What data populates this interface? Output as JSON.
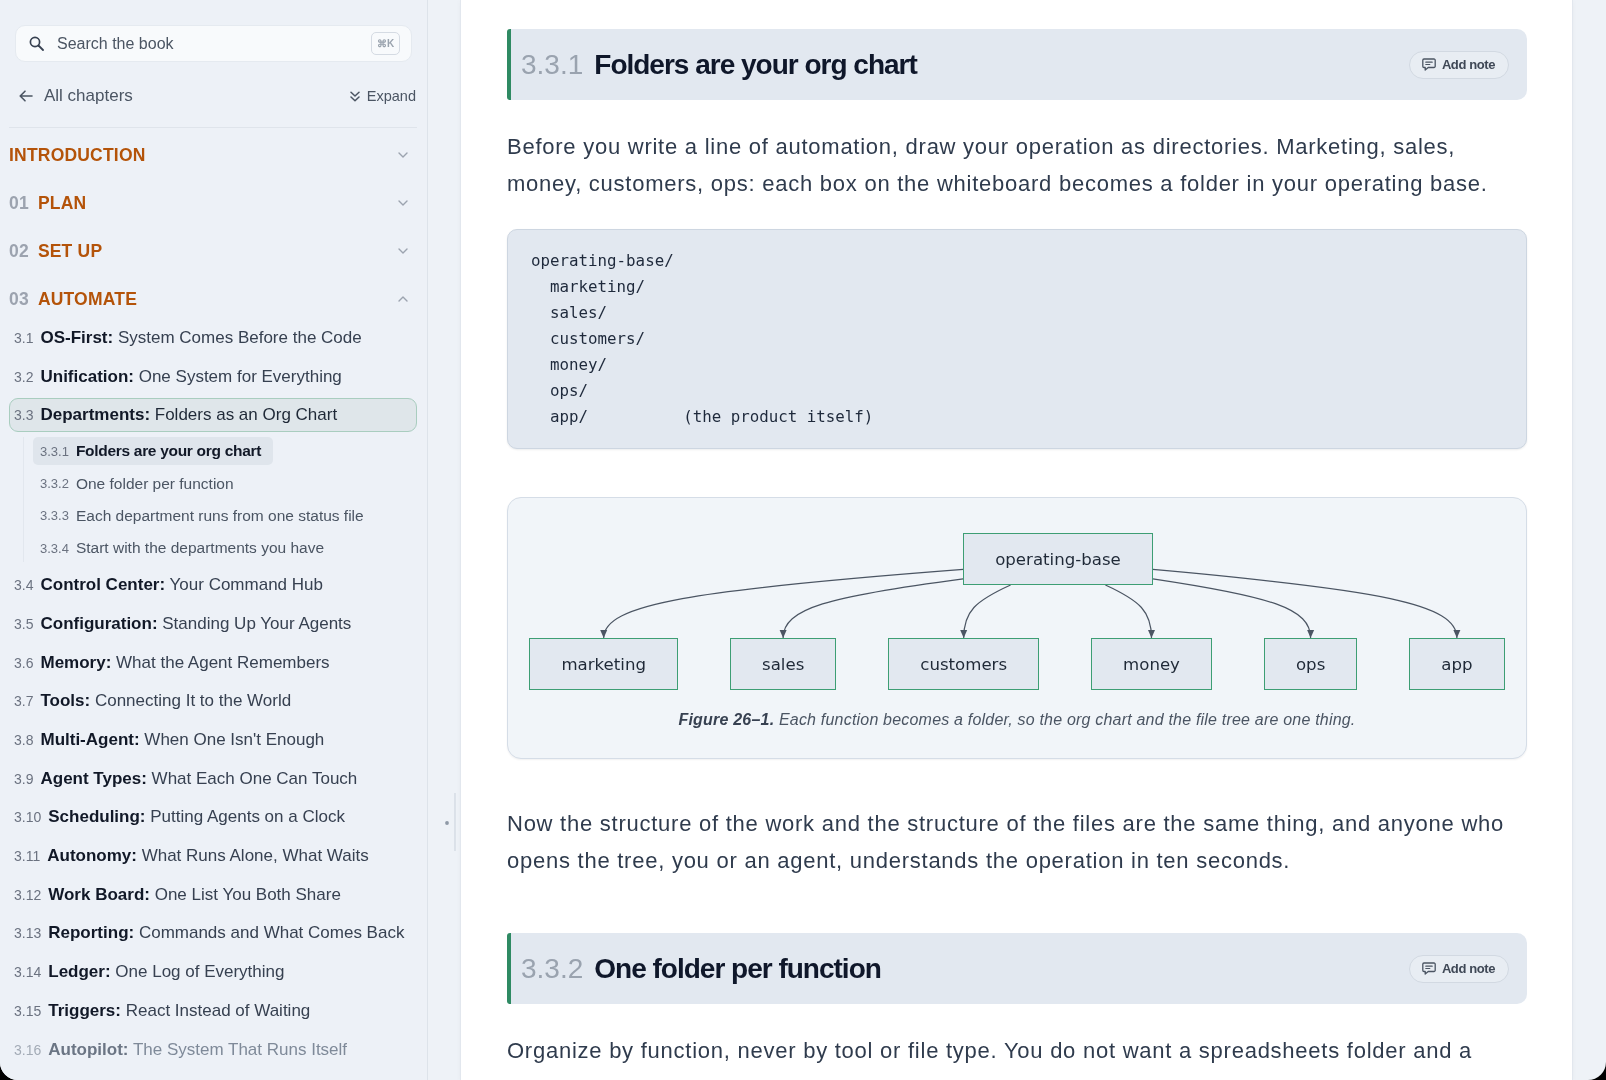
{
  "sidebar": {
    "search": {
      "placeholder": "Search the book",
      "shortcut": "⌘K"
    },
    "back_link": "All chapters",
    "expand_button": "Expand",
    "chapters": [
      {
        "title": "INTRODUCTION",
        "expanded": false
      },
      {
        "number": "01",
        "title": "PLAN",
        "expanded": false
      },
      {
        "number": "02",
        "title": "SET UP",
        "expanded": false
      },
      {
        "number": "03",
        "title": "AUTOMATE",
        "expanded": true,
        "sections": [
          {
            "number": "3.1",
            "title": "**OS-First:** System Comes Before the Code",
            "selected": false
          },
          {
            "number": "3.2",
            "title": "**Unification:** One System for Everything",
            "selected": false
          },
          {
            "number": "3.3",
            "title": "**Departments:** Folders as an Org Chart",
            "selected": true,
            "children": [
              {
                "number": "3.3.1",
                "title": "Folders are your org chart",
                "selected": true
              },
              {
                "number": "3.3.2",
                "title": "One folder per function",
                "selected": false
              },
              {
                "number": "3.3.3",
                "title": "Each department runs from one status file",
                "selected": false
              },
              {
                "number": "3.3.4",
                "title": "Start with the departments you have",
                "selected": false
              }
            ]
          },
          {
            "number": "3.4",
            "title": "**Control Center:** Your Command Hub",
            "selected": false
          },
          {
            "number": "3.5",
            "title": "**Configuration:** Standing Up Your Agents",
            "selected": false
          },
          {
            "number": "3.6",
            "title": "**Memory:** What the Agent Remembers",
            "selected": false
          },
          {
            "number": "3.7",
            "title": "**Tools:** Connecting It to the World",
            "selected": false
          },
          {
            "number": "3.8",
            "title": "**Multi-Agent:** When One Isn't Enough",
            "selected": false
          },
          {
            "number": "3.9",
            "title": "**Agent Types:** What Each One Can Touch",
            "selected": false
          },
          {
            "number": "3.10",
            "title": "**Scheduling:** Putting Agents on a Clock",
            "selected": false
          },
          {
            "number": "3.11",
            "title": "**Autonomy:** What Runs Alone, What Waits",
            "selected": false
          },
          {
            "number": "3.12",
            "title": "**Work Board:** One List You Both Share",
            "selected": false
          },
          {
            "number": "3.13",
            "title": "**Reporting:** Commands and What Comes Back",
            "selected": false
          },
          {
            "number": "3.14",
            "title": "**Ledger:** One Log of Everything",
            "selected": false
          },
          {
            "number": "3.15",
            "title": "**Triggers:** React Instead of Waiting",
            "selected": false
          },
          {
            "number": "3.16",
            "title": "**Autopilot:** The System That Runs Itself",
            "selected": false
          }
        ]
      }
    ]
  },
  "content": {
    "sections": [
      {
        "number": "3.3.1",
        "title": "Folders are your org chart",
        "add_note": "Add note",
        "blocks": [
          {
            "kind": "paragraph",
            "text": "Before you write a line of automation, draw your operation as directories. Marketing, sales, money, customers, ops: each box on the whiteboard becomes a folder in your operating base."
          },
          {
            "kind": "code",
            "lines": [
              "operating-base/",
              "  marketing/",
              "  sales/",
              "  customers/",
              "  money/",
              "  ops/",
              "  app/          (the product itself)"
            ]
          },
          {
            "kind": "figure",
            "diagram": {
              "root": "operating-base",
              "children": [
                "marketing",
                "sales",
                "customers",
                "money",
                "ops",
                "app"
              ]
            },
            "caption": "**Figure 26–1.** Each function becomes a folder, so the org chart and the file tree are one thing."
          },
          {
            "kind": "paragraph",
            "text": "Now the structure of the work and the structure of the files are the same thing, and anyone who opens the tree, you or an agent, understands the operation in ten seconds."
          }
        ]
      },
      {
        "number": "3.3.2",
        "title": "One folder per function",
        "add_note": "Add note",
        "blocks": [
          {
            "kind": "paragraph",
            "text": "Organize by function, never by tool or file type. You do not want a spreadsheets folder and a"
          }
        ]
      }
    ]
  }
}
